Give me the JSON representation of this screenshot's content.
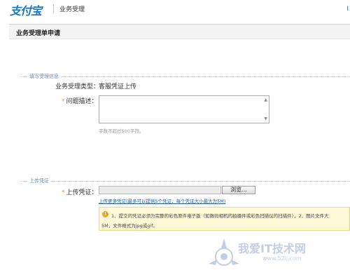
{
  "header": {
    "logo_text": "支付宝",
    "title": "业务受理",
    "corner_text": "I"
  },
  "page": {
    "title": "业务受理单申请"
  },
  "section_fill": {
    "legend": "填写受理信息",
    "type_label": "业务受理类型：",
    "type_value": "客服凭证上传",
    "required_mark": "*",
    "desc_label": "问题描述：",
    "desc_value": "",
    "desc_hint": "字数不超过500字符。"
  },
  "section_upload": {
    "legend": "上传凭证",
    "required_mark": "*",
    "upload_label": "上传凭证：",
    "file_value": "",
    "browse_label": "浏览...",
    "more_link": "上传更多凭证(最多可以提供5个凭证，每个凭证大小最大为5M)",
    "notice_number": "!",
    "notice_line1": "1、提交的凭证必须为完整的彩色原件电子版（如数码相机的拍摄件或彩色扫描仪的扫描件），2、图片文件大",
    "notice_line2": "5M，文件格式为jpg或gif。"
  },
  "watermark": {
    "text": "我爱IT技术网",
    "url": "www.52ij.com"
  },
  "colors": {
    "brand": "#1877c7",
    "link": "#1c5ea8",
    "required": "#f39b2d",
    "notice_bg": "#fff8d6"
  }
}
